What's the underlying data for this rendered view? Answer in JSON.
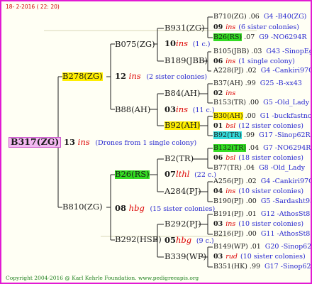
{
  "header": {
    "date_text": "18-  2-2016 ( 22: 20)"
  },
  "footer": {
    "copyright": "Copyright 2004-2016 @ Karl Kehrle Foundation.   www.pedigreeapis.org"
  },
  "gen0": {
    "name": "B317(ZG)"
  },
  "gen1": [
    {
      "name": "B278(ZG)",
      "num": "12",
      "ins": "ins",
      "note": "(2 sister colonies)"
    },
    {
      "name": "B810(ZG)",
      "num": "08",
      "ins": "hbg",
      "note": "(15 sister colonies)"
    }
  ],
  "gen1_link": {
    "num": "13",
    "ins": "ins",
    "note": "(Drones from 1 single colony)"
  },
  "gen2": [
    {
      "name": "B075(ZG)"
    },
    {
      "name": "B88(AH)"
    },
    {
      "name": "B26(RS)"
    },
    {
      "name": "B292(HSB)"
    }
  ],
  "gen3": [
    {
      "name": "B931(ZG)",
      "num": "10",
      "ins": "ins",
      "note": "(1 c.)"
    },
    {
      "name": "B189(JBB)"
    },
    {
      "name": "B84(AH)",
      "num": "03",
      "ins": "ins",
      "note": "(11 c.)"
    },
    {
      "name": "B92(AH)"
    },
    {
      "name": "B2(TR)",
      "num": "07",
      "ins": "lthl",
      "note": "(22 c.)"
    },
    {
      "name": "A284(PJ)"
    },
    {
      "name": "B292(PJ)",
      "num": "05",
      "ins": "hbg",
      "note": "(9 c.)"
    },
    {
      "name": "B339(WP)"
    }
  ],
  "gen4": [
    {
      "name": "B710(ZG)",
      "year": ".06",
      "ref": "G4 -B40(ZG)",
      "num": "09",
      "ins": "ins",
      "note": "(6 sister colonies)"
    },
    {
      "name": "B26(RS)",
      "year": ".07",
      "ref": "G9 -NO6294R"
    },
    {
      "name": "B105(JBB)",
      "year": ".03",
      "ref": "G43 -SinopEgg86R",
      "num": "06",
      "ins": "ins",
      "note": "(1 single colony)"
    },
    {
      "name": "A228(PJ)",
      "year": ".02",
      "ref": "G4 -Cankiri97Q"
    },
    {
      "name": "B37(AH)",
      "year": ".99",
      "ref": "G25 -B-xx43",
      "num": "02",
      "ins": "ins",
      "note": ""
    },
    {
      "name": "B153(TR)",
      "year": ".00",
      "ref": "G5 -Old_Lady"
    },
    {
      "name": "B30(AH)",
      "year": ".00",
      "ref": "G1 -buckfastno",
      "num": "01",
      "ins": "bsl",
      "note": "(12 sister colonies)"
    },
    {
      "name": "B92(TR)",
      "year": ".99",
      "ref": "G17 -Sinop62R"
    },
    {
      "name": "B132(TR)",
      "year": ".04",
      "ref": "G7 -NO6294R",
      "num": "06",
      "ins": "bsl",
      "note": "(18 sister colonies)"
    },
    {
      "name": "B77(TR)",
      "year": ".04",
      "ref": "G8 -Old_Lady"
    },
    {
      "name": "A256(PJ)",
      "year": ".02",
      "ref": "G4 -Cankiri97Q",
      "num": "04",
      "ins": "ins",
      "note": "(10 sister colonies)"
    },
    {
      "name": "B190(PJ)",
      "year": ".00",
      "ref": "G5 -Sardasht93R"
    },
    {
      "name": "B191(PJ)",
      "year": ".01",
      "ref": "G12 -AthosSt80R",
      "num": "03",
      "ins": "ins",
      "note": "(10 sister colonies)"
    },
    {
      "name": "B216(PJ)",
      "year": ".00",
      "ref": "G11 -AthosSt80R"
    },
    {
      "name": "B149(WP)",
      "year": ".01",
      "ref": "G20 -Sinop62R",
      "num": "03",
      "ins": "rud",
      "note": "(10 sister colonies)"
    },
    {
      "name": "B351(HK)",
      "year": ".99",
      "ref": "G17 -Sinop62R"
    }
  ],
  "colors": {
    "border": "#e21ad3",
    "highlight_yellow": "#ffee00",
    "highlight_green": "#33dd22",
    "highlight_cyan": "#33dddd",
    "highlight_pink": "#f2b8f0",
    "mating_red": "#dd0000",
    "note_blue": "#2a2ad0"
  }
}
